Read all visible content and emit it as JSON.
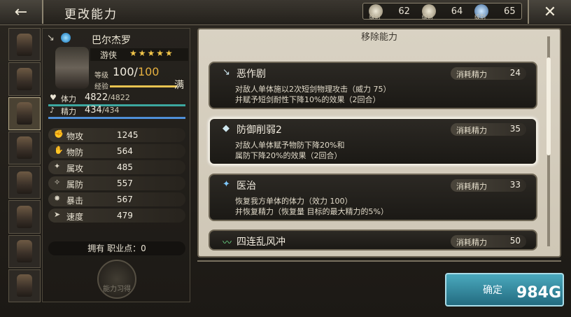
{
  "header": {
    "title": "更改能力",
    "levels": [
      {
        "value": "62",
        "tag": "级别"
      },
      {
        "value": "64",
        "tag": "级别"
      },
      {
        "value": "65",
        "tag": "级别"
      }
    ]
  },
  "character": {
    "name": "巴尔杰罗",
    "job": "游侠",
    "stars": "★★★★★",
    "level_label": "等级",
    "level": "100",
    "level_max": "100",
    "exp_label": "经验",
    "full_label": "满",
    "hp_label": "体力",
    "hp": "4822",
    "hp_max": "4822",
    "sp_label": "精力",
    "sp": "434",
    "sp_max": "434",
    "stats": [
      {
        "label": "物攻",
        "value": "1245"
      },
      {
        "label": "物防",
        "value": "564"
      },
      {
        "label": "属攻",
        "value": "485"
      },
      {
        "label": "属防",
        "value": "557"
      },
      {
        "label": "暴击",
        "value": "567"
      },
      {
        "label": "速度",
        "value": "479"
      }
    ],
    "job_points": "拥有 职业点：0",
    "learn_button": "能力习得"
  },
  "skills": {
    "header": "移除能力",
    "cost_label": "消耗精力",
    "items": [
      {
        "name": "恶作剧",
        "cost": "24",
        "desc1": "对敌人单体施以2次短剑物理攻击（威力 75）",
        "desc2": "并赋予短剑耐性下降10%的效果（2回合）"
      },
      {
        "name": "防御削弱2",
        "cost": "35",
        "desc1": "对敌人单体赋予物防下降20%和",
        "desc2": "属防下降20%的效果（2回合）"
      },
      {
        "name": "医治",
        "cost": "33",
        "desc1": "恢复我方单体的体力（效力 100）",
        "desc2": "并恢复精力（恢复量 目标的最大精力的5%）"
      },
      {
        "name": "四连乱风冲",
        "cost": "50",
        "desc1": "",
        "desc2": ""
      }
    ]
  },
  "confirm_button": "确定",
  "watermark": "984G"
}
